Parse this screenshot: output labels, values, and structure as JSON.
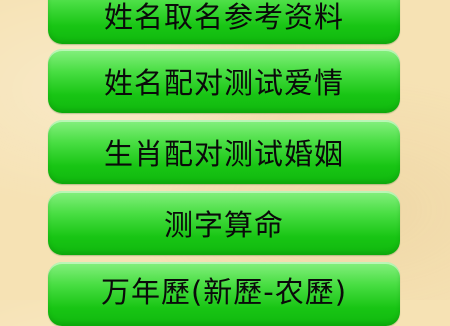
{
  "menu": {
    "items": [
      {
        "label": "姓名取名参考资料"
      },
      {
        "label": "姓名配对测试爱情"
      },
      {
        "label": "生肖配对测试婚姻"
      },
      {
        "label": "测字算命"
      },
      {
        "label": "万年歷(新歷-农歷)"
      }
    ]
  },
  "colors": {
    "background": "#f6e2b4",
    "button_green": "#2fd22a",
    "text": "#0a0a0a"
  }
}
